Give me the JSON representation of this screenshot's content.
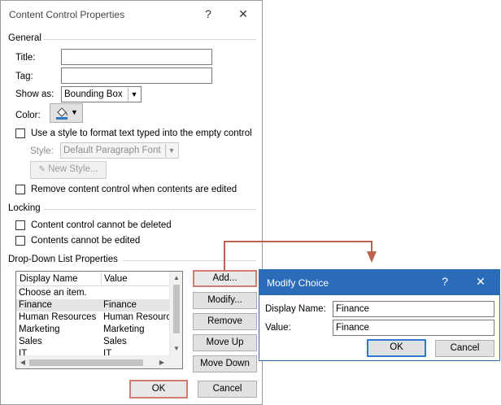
{
  "main_dialog": {
    "title": "Content Control Properties",
    "help": "?",
    "close": "✕",
    "general": {
      "heading": "General",
      "title_label": "Title:",
      "title_value": "",
      "tag_label": "Tag:",
      "tag_value": "",
      "show_as_label": "Show as:",
      "show_as_value": "Bounding Box",
      "color_label": "Color:",
      "use_style_label": "Use a style to format text typed into the empty control",
      "style_label": "Style:",
      "style_value": "Default Paragraph Font",
      "new_style_label": "New Style...",
      "remove_label": "Remove content control when contents are edited"
    },
    "locking": {
      "heading": "Locking",
      "cannot_delete": "Content control cannot be deleted",
      "cannot_edit": "Contents cannot be edited"
    },
    "dropdown": {
      "heading": "Drop-Down List Properties",
      "col_display": "Display Name",
      "col_value": "Value",
      "rows": [
        {
          "display": "Choose an item.",
          "value": ""
        },
        {
          "display": "Finance",
          "value": "Finance"
        },
        {
          "display": "Human Resources",
          "value": "Human Resources"
        },
        {
          "display": "Marketing",
          "value": "Marketing"
        },
        {
          "display": "Sales",
          "value": "Sales"
        },
        {
          "display": "IT",
          "value": "IT"
        }
      ],
      "selected_row": 1
    },
    "buttons": {
      "add": "Add...",
      "modify": "Modify...",
      "remove": "Remove",
      "move_up": "Move Up",
      "move_down": "Move Down",
      "ok": "OK",
      "cancel": "Cancel"
    },
    "icons": [
      "paint-bucket-icon",
      "chevron-down-icon",
      "scroll-up-icon",
      "scroll-down-icon",
      "scroll-left-icon",
      "scroll-right-icon"
    ]
  },
  "modify_dialog": {
    "title": "Modify Choice",
    "help": "?",
    "close": "✕",
    "display_name_label": "Display Name:",
    "display_name_value": "Finance",
    "value_label": "Value:",
    "value_value": "Finance",
    "ok": "OK",
    "cancel": "Cancel"
  },
  "colors": {
    "modify_titlebar": "#2b6cb9",
    "highlight": "#c06050"
  }
}
